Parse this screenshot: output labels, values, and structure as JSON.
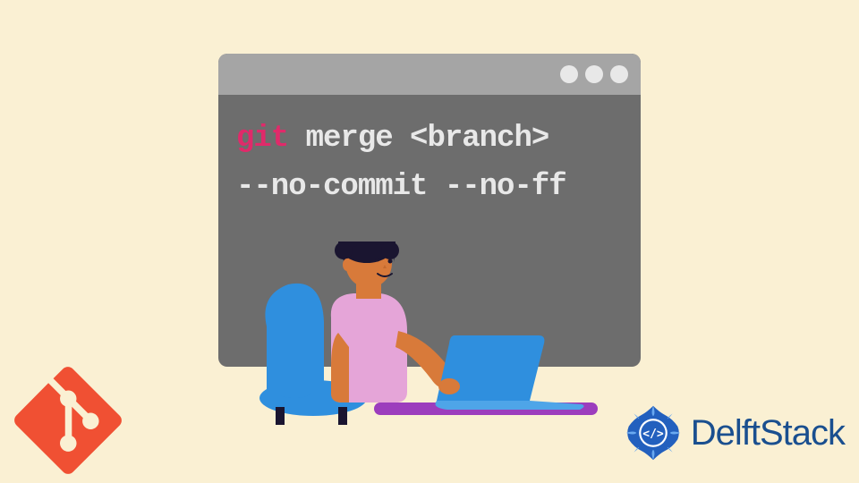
{
  "terminal": {
    "command_prefix": "git",
    "command_rest": " merge <branch>",
    "command_line2": "--no-commit --no-ff"
  },
  "branding": {
    "delftstack": "DelftStack"
  },
  "colors": {
    "background": "#faf0d3",
    "terminal_body": "#6d6d6d",
    "terminal_titlebar": "#a5a5a5",
    "git_keyword": "#e02a6a",
    "terminal_text": "#e8e8e8",
    "git_logo": "#f05033",
    "delftstack_blue": "#1a4f8f",
    "chair": "#2f8fde",
    "shirt": "#e5a5d8",
    "skin": "#d87a3a",
    "hair": "#1a1530",
    "laptop": "#2f8fde",
    "desk": "#9c3dbd"
  }
}
